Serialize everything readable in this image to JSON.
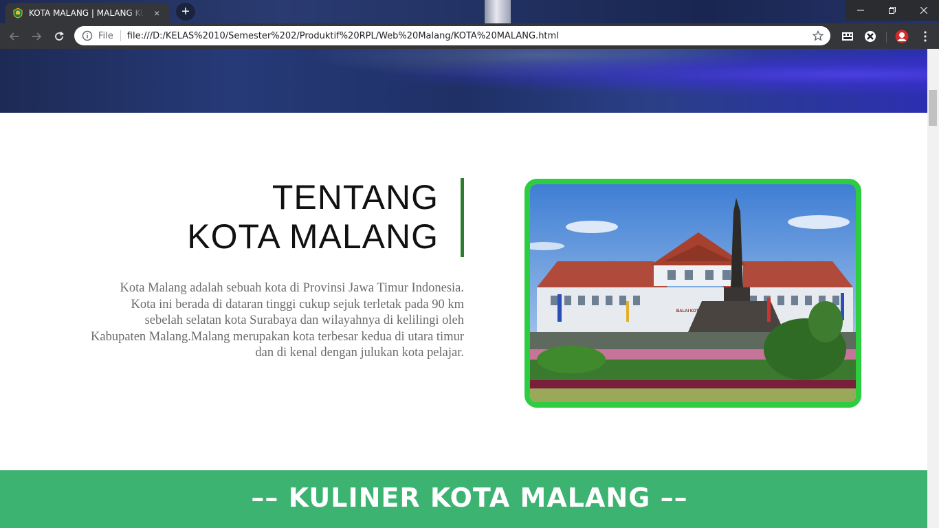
{
  "browser": {
    "tab_title": "KOTA MALANG | MALANG KUCECWARA",
    "tab_close_glyph": "×",
    "new_tab_glyph": "+",
    "address_scheme_label": "File",
    "address_url": "file:///D:/KELAS%2010/Semester%202/Produktif%20RPL/Web%20Malang/KOTA%20MALANG.html"
  },
  "about": {
    "title_line1": "TENTANG",
    "title_line2": "KOTA MALANG",
    "paragraph_line1": "Kota Malang adalah sebuah kota di Provinsi Jawa Timur Indonesia.",
    "paragraph_line2": "Kota ini berada di dataran tinggi cukup sejuk terletak pada 90 km",
    "paragraph_line3": "sebelah selatan kota Surabaya dan wilayahnya di kelilingi oleh",
    "paragraph_line4": "Kabupaten Malang.Malang merupakan kota terbesar kedua di utara timur",
    "paragraph_line5": "dan di kenal dengan julukan kota pelajar.",
    "photo_sign": "BALAI KOTA MALANG"
  },
  "section": {
    "heading": "–– KULINER KOTA MALANG ––"
  },
  "colors": {
    "accent_green": "#2ecc40",
    "bar_green": "#2e7d2e",
    "band_green": "#3cb371",
    "chrome_dark": "#35363a"
  },
  "icons": [
    "malang-logo-icon",
    "close-icon",
    "plus-icon",
    "minimize-icon",
    "restore-icon",
    "window-close-icon",
    "back-arrow-icon",
    "forward-arrow-icon",
    "reload-icon",
    "info-icon",
    "star-icon",
    "extension-icon",
    "profile-avatar-icon",
    "kebab-menu-icon"
  ]
}
